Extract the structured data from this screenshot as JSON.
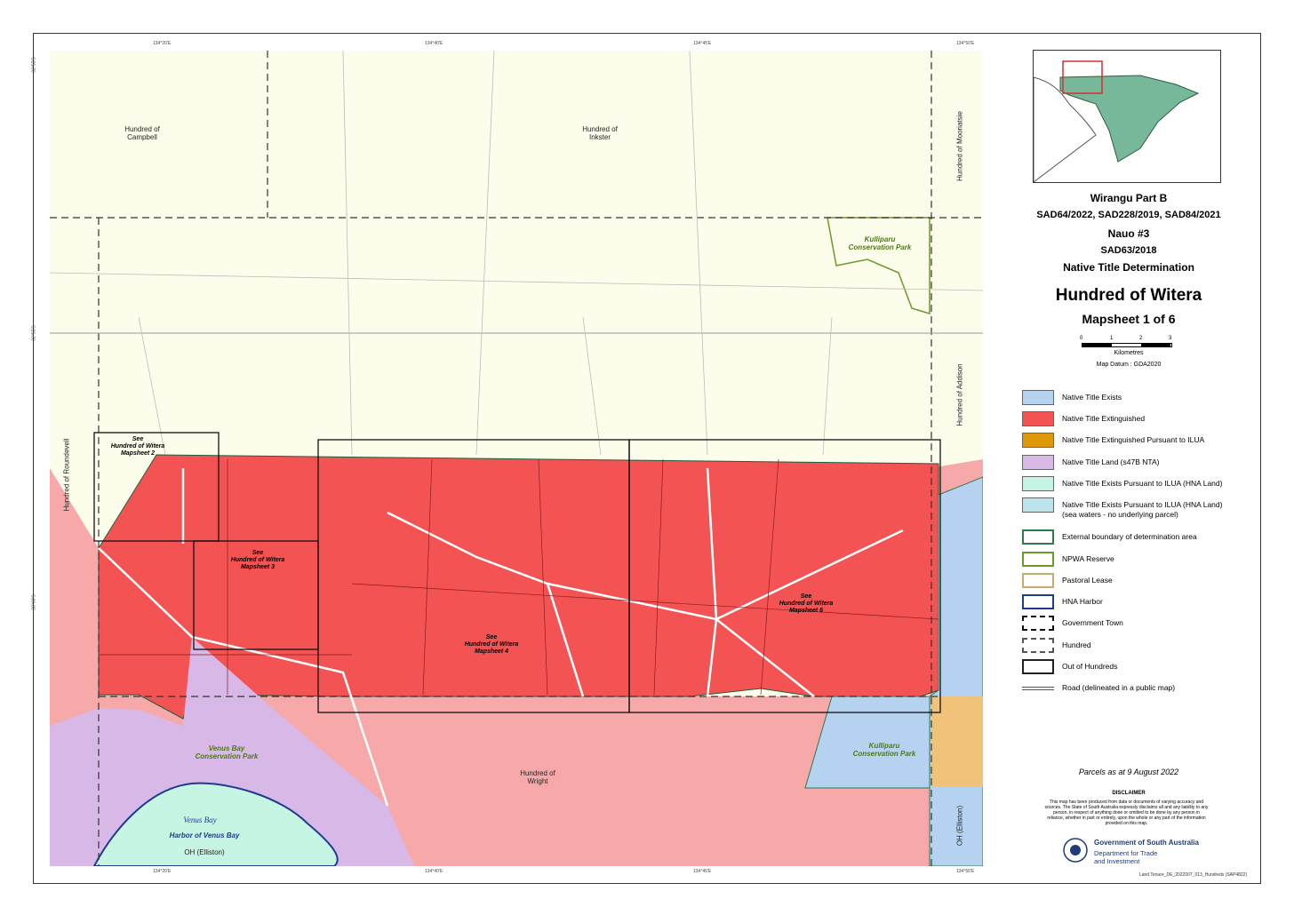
{
  "title_block": {
    "line1": "Wirangu Part B",
    "line2": "SAD64/2022, SAD228/2019, SAD84/2021",
    "line3": "Nauo #3",
    "line4": "SAD63/2018",
    "line5": "Native Title Determination",
    "hundred": "Hundred of Witera",
    "mapsheet": "Mapsheet 1 of 6",
    "scale_ticks": [
      "0",
      "1",
      "2",
      "3"
    ],
    "scale_unit": "Kilometres",
    "datum": "Map Datum : GDA2020"
  },
  "legend": [
    {
      "label": "Native Title Exists",
      "color": "#b5d3f0"
    },
    {
      "label": "Native Title Extinguished",
      "color": "#f45353"
    },
    {
      "label": "Native Title Extinguished Pursuant to ILUA",
      "color": "#e0980a"
    },
    {
      "label": "Native Title Land (s47B NTA)",
      "color": "#d8b8e6"
    },
    {
      "label": "Native Title Exists Pursuant to ILUA (HNA Land)",
      "color": "#c7f5e3"
    },
    {
      "label": "Native Title Exists Pursuant to ILUA (HNA Land)",
      "label2": "(sea waters - no underlying parcel)",
      "color": "#bde3ec"
    },
    {
      "label": "External boundary of determination area",
      "color": "#ffffff",
      "border": "#2e7a4c"
    },
    {
      "label": "NPWA Reserve",
      "color": "#ffffff",
      "border": "#6a9a2a"
    },
    {
      "label": "Pastoral Lease",
      "color": "#ffffff",
      "border": "#c4ac74"
    },
    {
      "label": "HNA Harbor",
      "color": "#ffffff",
      "border": "#1f3b8e"
    },
    {
      "label": "Government Town",
      "color": "#ffffff",
      "border": "#111111"
    },
    {
      "label": "Hundred",
      "color": "#ffffff",
      "border": "#555555"
    },
    {
      "label": "Out of Hundreds",
      "color": "#ffffff",
      "border": "#222222"
    },
    {
      "label": "Road (delineated in a public map)",
      "color": "#ffffff"
    }
  ],
  "parcels_note": "Parcels as at 9 August 2022",
  "disclaimer": {
    "title": "DISCLAIMER",
    "text": "This map has been produced from data or documents of varying accuracy and sources. The State of South Australia expressly disclaims all and any liability to any person, in respect of anything done or omitted to be done by any person in reliance, whether in part or entirely, upon the whole or any part of the information provided on this map."
  },
  "government": {
    "line1": "Government of South Australia",
    "line2": "Department for Trade",
    "line3": "and Investment"
  },
  "doc_ref": "Land Tenure_DE_2022007_013_Hundreds (SAP4822)",
  "map_labels": {
    "campbell": "Hundred of\nCampbell",
    "inkster": "Hundred of\nInkster",
    "mooriatsie": "Hundred of Mooriatsie",
    "addison": "Hundred of Addison",
    "roundevell": "Hundred of Roundevell",
    "wright": "Hundred of\nWright",
    "kulliparu_n": "Kulliparu\nConservation Park",
    "kulliparu_s": "Kulliparu\nConservation Park",
    "venus_cp": "Venus Bay\nConservation Park",
    "venus_bay": "Venus Bay",
    "harbor": "Harbor of Venus Bay",
    "oh1": "OH (Elliston)",
    "oh2": "OH (Elliston)",
    "see2": "See\nHundred of Witera\nMapsheet 2",
    "see3": "See\nHundred of Witera\nMapsheet 3",
    "see4": "See\nHundred of Witera\nMapsheet 4",
    "see6": "See\nHundred of Witera\nMapsheet 6"
  },
  "coord_ticks": {
    "top": [
      "134°20'E",
      "134°40'E",
      "134°45'E",
      "134°50'E"
    ],
    "left": [
      "32°55'S",
      "32°55'S",
      "33°00'S"
    ]
  },
  "colors": {
    "extinguished": "#f45353",
    "exists": "#b5d3f0",
    "pink": "#f7a8a8",
    "cream": "#fdfdec",
    "purple": "#d8b8e6",
    "hna": "#c7f5e3",
    "pastoral_fill": "#f0c27a"
  }
}
